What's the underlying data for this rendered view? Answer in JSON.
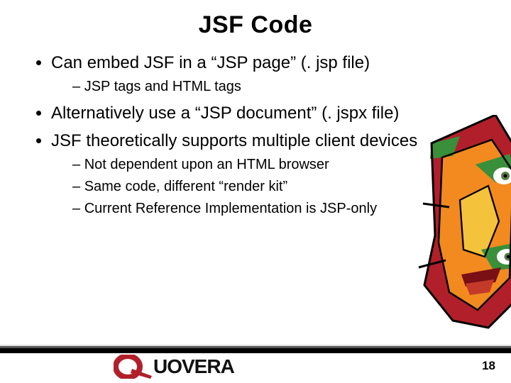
{
  "title": "JSF Code",
  "bullets": [
    {
      "text": "Can embed JSF in a “JSP page” (. jsp file)",
      "sub": [
        "JSP tags and HTML tags"
      ]
    },
    {
      "text": "Alternatively use a “JSP document” (. jspx file)",
      "sub": []
    },
    {
      "text": "JSF theoretically supports multiple client devices",
      "sub": [
        "Not dependent upon an HTML browser",
        "Same code, different “render kit”",
        "Current Reference Implementation is JSP-only"
      ]
    }
  ],
  "logo_text": "UOVERA",
  "page_number": "18"
}
